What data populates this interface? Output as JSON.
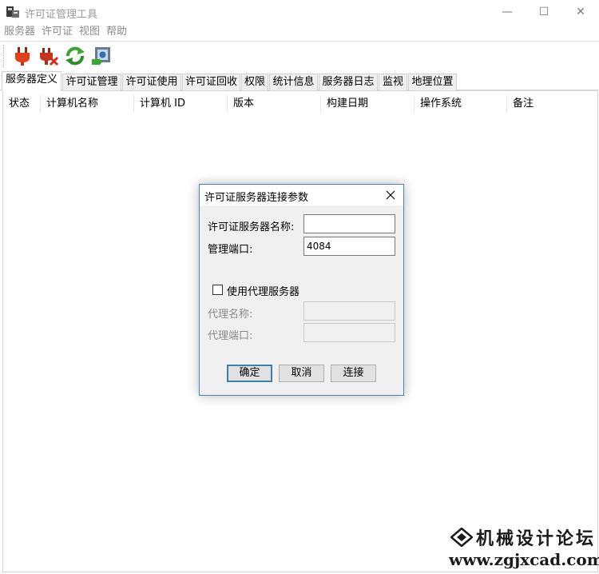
{
  "window": {
    "title": "许可证管理工具",
    "minimize_glyph": "—",
    "maximize_glyph": "☐",
    "close_glyph": "✕"
  },
  "menu": [
    "服务器",
    "许可证",
    "视图",
    "帮助"
  ],
  "toolbar": {
    "buttons": [
      {
        "icon": "plug-connect-icon",
        "color": "#e2401c"
      },
      {
        "icon": "plug-disconnect-icon",
        "color": "#c8341a"
      },
      {
        "icon": "refresh-icon",
        "color": "#3aa630"
      },
      {
        "icon": "server-settings-icon",
        "color": "#2f6fb3"
      }
    ]
  },
  "tabs": [
    "服务器定义",
    "许可证管理",
    "许可证使用",
    "许可证回收",
    "权限",
    "统计信息",
    "服务器日志",
    "监视",
    "地理位置"
  ],
  "active_tab": "服务器定义",
  "table": {
    "columns": [
      "状态",
      "计算机名称",
      "计算机 ID",
      "版本",
      "构建日期",
      "操作系统",
      "备注"
    ],
    "rows": []
  },
  "dialog": {
    "title": "许可证服务器连接参数",
    "server_name_label": "许可证服务器名称:",
    "server_name_value": "",
    "admin_port_label": "管理端口:",
    "admin_port_value": "4084",
    "use_proxy_label": "使用代理服务器",
    "use_proxy_checked": false,
    "proxy_name_label": "代理名称:",
    "proxy_name_value": "",
    "proxy_port_label": "代理端口:",
    "proxy_port_value": "",
    "ok_label": "确定",
    "cancel_label": "取消",
    "connect_label": "连接"
  },
  "watermark": {
    "title": "机械设计论坛",
    "url": "www.zgjxcad.com"
  }
}
